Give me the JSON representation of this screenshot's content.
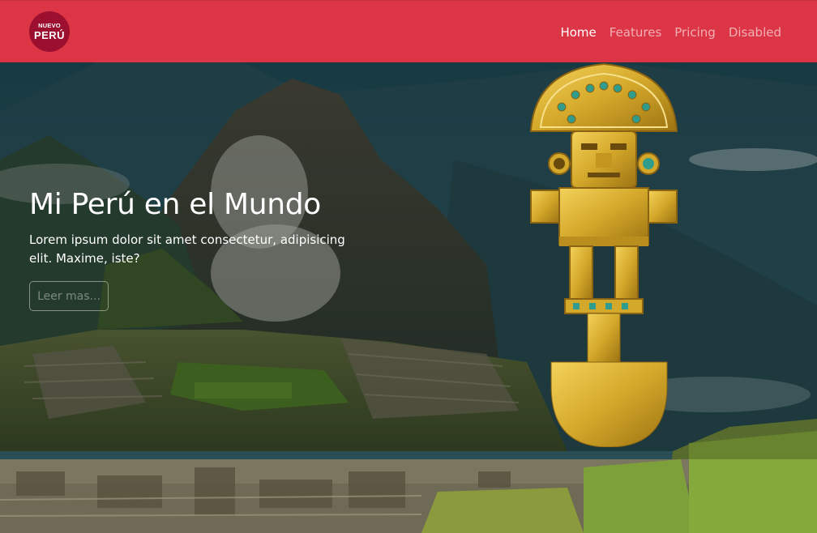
{
  "brand": {
    "logo_line1": "NUEVO",
    "logo_line2": "PERÚ"
  },
  "nav": {
    "items": [
      {
        "label": "Home",
        "active": true
      },
      {
        "label": "Features",
        "active": false
      },
      {
        "label": "Pricing",
        "active": false
      },
      {
        "label": "Disabled",
        "active": false
      }
    ]
  },
  "hero": {
    "title": "Mi Perú en el Mundo",
    "text": "Lorem ipsum dolor sit amet consectetur, adipisicing elit. Maxime, iste?",
    "button_label": "Leer mas..."
  },
  "colors": {
    "navbar": "#dc3545",
    "logo_bg": "#9c0f2f",
    "gold": "#d4a82a"
  },
  "images": {
    "background": "machu-picchu-landscape",
    "foreground": "tumi-gold-figure"
  }
}
